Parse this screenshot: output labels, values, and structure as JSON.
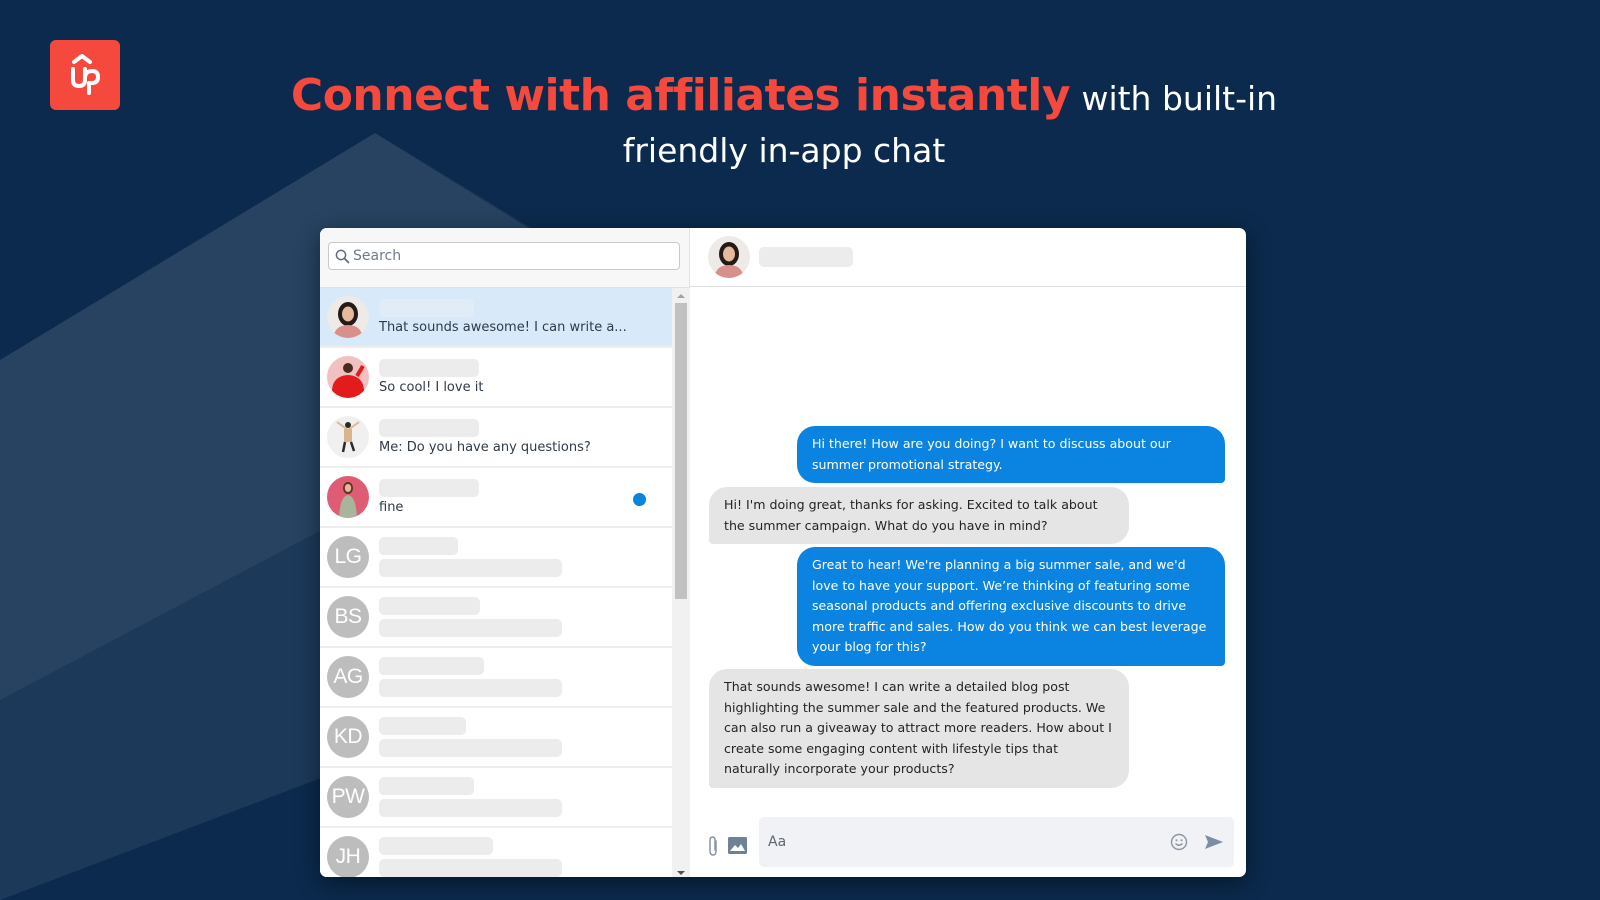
{
  "brand": {
    "logo_icon": "up-logo-icon",
    "logo_color": "#f5493d",
    "background_color": "#0b2a4d"
  },
  "headline": {
    "accent_text": "Connect with affiliates instantly",
    "rest_line1": "with built-in",
    "rest_line2": "friendly in-app chat"
  },
  "sidebar": {
    "search": {
      "placeholder": "Search",
      "value": "",
      "icon": "search-icon"
    },
    "conversations": [
      {
        "avatar_type": "photo",
        "avatar_desc": "woman-pink-top",
        "name_hidden": true,
        "preview": "That sounds awesome! I can write a...",
        "active": true,
        "unread": false
      },
      {
        "avatar_type": "photo",
        "avatar_desc": "man-red-hoodie",
        "name_hidden": true,
        "preview": "So cool! I love it",
        "active": false,
        "unread": false
      },
      {
        "avatar_type": "photo",
        "avatar_desc": "jumping-woman",
        "name_hidden": true,
        "preview": "Me: Do you have any questions?",
        "active": false,
        "unread": false
      },
      {
        "avatar_type": "photo",
        "avatar_desc": "woman-pink-background",
        "name_hidden": true,
        "preview": "fine",
        "active": false,
        "unread": true
      },
      {
        "avatar_type": "initials",
        "initials": "LG",
        "name_hidden": true,
        "preview_hidden": true
      },
      {
        "avatar_type": "initials",
        "initials": "BS",
        "name_hidden": true,
        "preview_hidden": true
      },
      {
        "avatar_type": "initials",
        "initials": "AG",
        "name_hidden": true,
        "preview_hidden": true
      },
      {
        "avatar_type": "initials",
        "initials": "KD",
        "name_hidden": true,
        "preview_hidden": true
      },
      {
        "avatar_type": "initials",
        "initials": "PW",
        "name_hidden": true,
        "preview_hidden": true
      },
      {
        "avatar_type": "initials",
        "initials": "JH",
        "name_hidden": true,
        "preview_hidden": true
      }
    ],
    "unread_dot_color": "#0a84d6",
    "active_row_color": "#d8eaf9"
  },
  "chat": {
    "header": {
      "avatar_desc": "woman-pink-top",
      "name_hidden": true
    },
    "messages": [
      {
        "direction": "out",
        "text": "Hi there! How are you doing? I want to discuss about our summer promotional strategy."
      },
      {
        "direction": "in",
        "text": "Hi! I'm doing great, thanks for asking. Excited to talk about the summer campaign. What do you have in mind?"
      },
      {
        "direction": "out",
        "text": "Great to hear! We're planning a big summer sale, and we'd love to have your support. We’re thinking of featuring some seasonal products and offering exclusive discounts to drive more traffic and sales. How do you think we can best leverage your blog for this?"
      },
      {
        "direction": "in",
        "text": " That sounds awesome! I can write a detailed blog post highlighting the summer sale and the featured products. We can also run a giveaway to attract more readers. How about I create some engaging content with lifestyle tips that naturally incorporate your products?"
      }
    ],
    "outgoing_color": "#0a84e0",
    "incoming_color": "#e5e5e6",
    "composer": {
      "placeholder": "Aa",
      "value": "",
      "icons": [
        "paperclip-icon",
        "image-icon",
        "emoji-icon",
        "send-icon"
      ]
    }
  }
}
